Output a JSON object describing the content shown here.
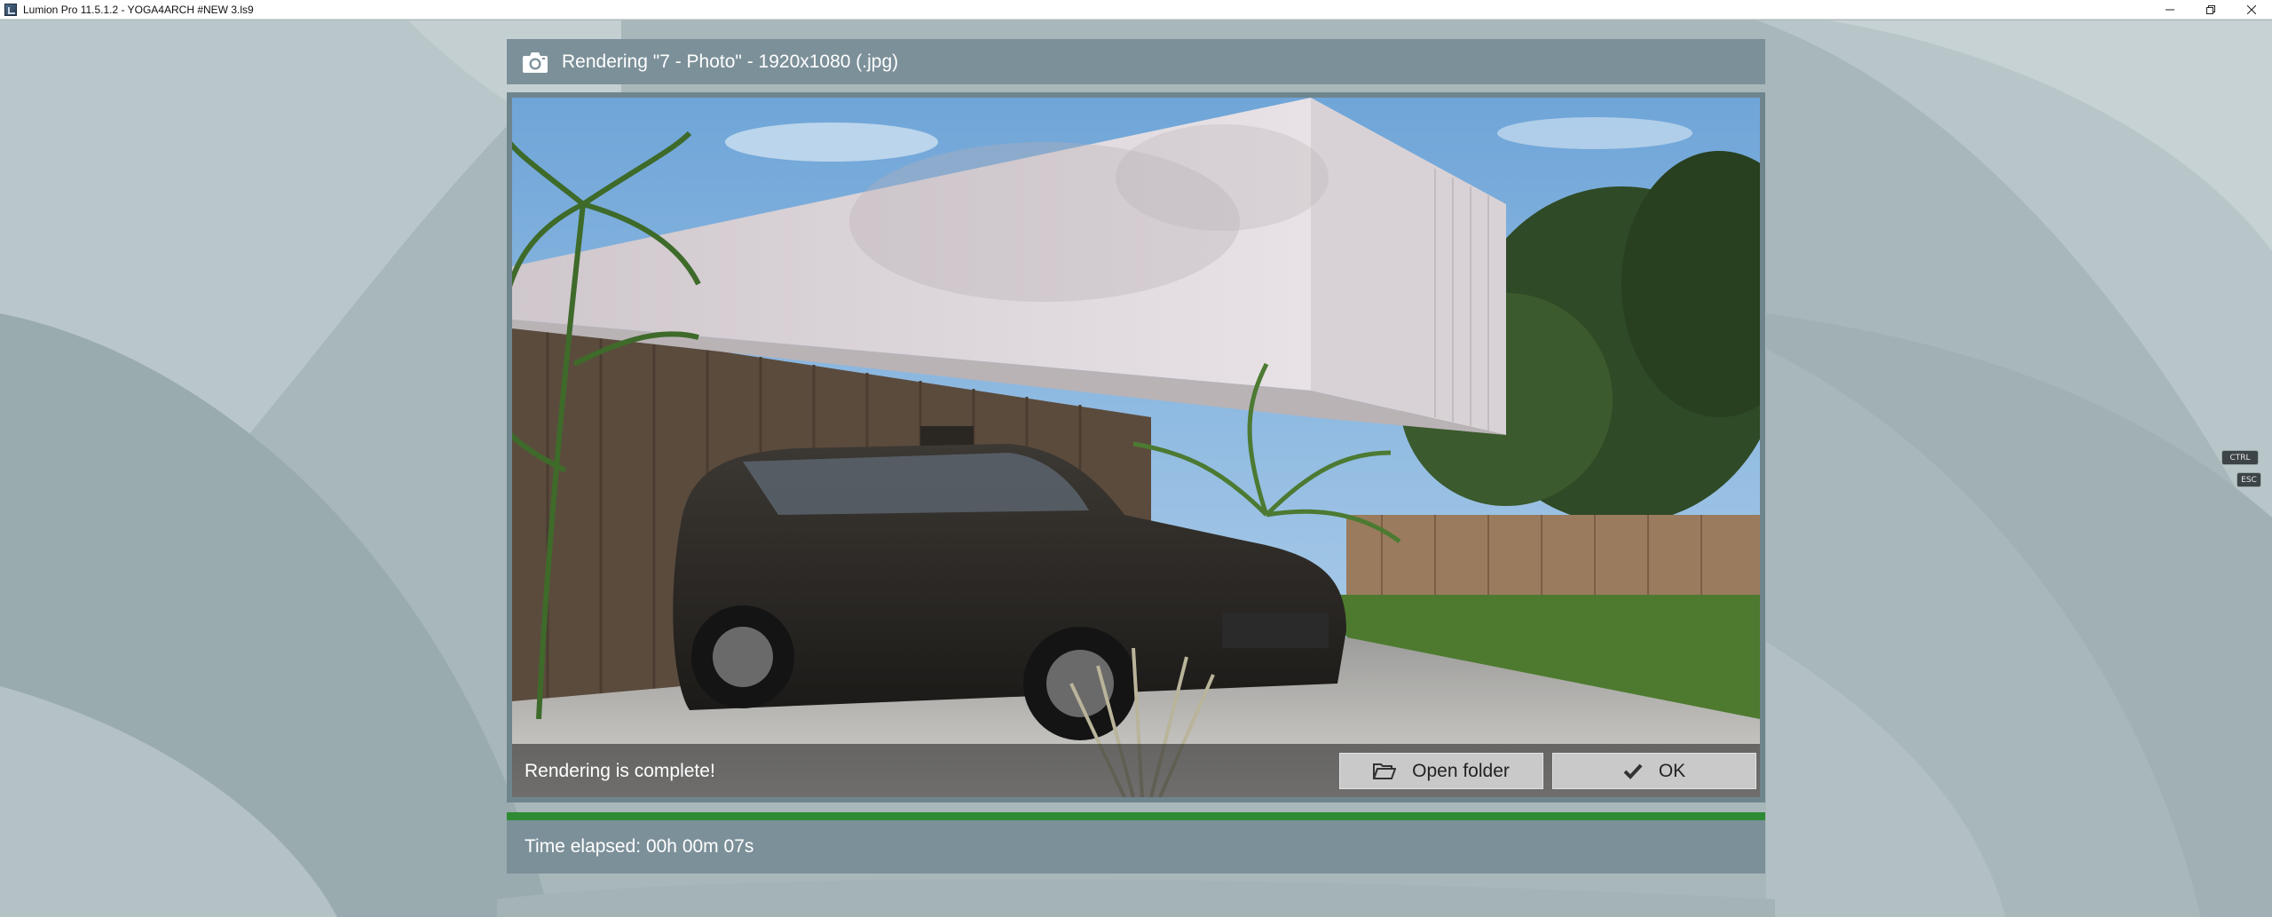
{
  "window": {
    "title": "Lumion Pro 11.5.1.2  - YOGA4ARCH #NEW 3.ls9"
  },
  "dialog": {
    "title": "Rendering \"7 - Photo\" - 1920x1080 (.jpg)",
    "status": "Rendering is complete!",
    "open_folder_label": "Open folder",
    "ok_label": "OK",
    "time_elapsed": "Time elapsed: 00h 00m 07s",
    "progress_fraction": 1.0
  },
  "keys": {
    "ctrl": "CTRL",
    "esc": "ESC"
  },
  "colors": {
    "accent_progress": "#2e8b33",
    "panel": "#7c9099",
    "background": "#a9b8bb"
  },
  "icons": [
    "app-icon",
    "camera-icon",
    "folder-open-icon",
    "checkmark-icon",
    "minimize-icon",
    "restore-icon",
    "close-icon"
  ]
}
